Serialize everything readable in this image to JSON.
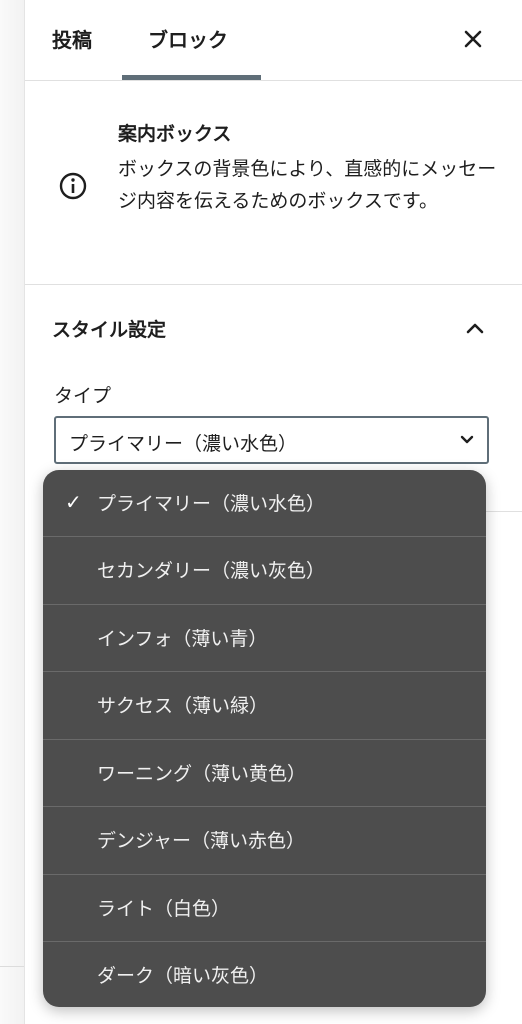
{
  "tabs": {
    "post": "投稿",
    "block": "ブロック"
  },
  "block": {
    "title": "案内ボックス",
    "description": "ボックスの背景色により、直感的にメッセージ内容を伝えるためのボックスです。"
  },
  "style_settings": {
    "header": "スタイル設定",
    "type_label": "タイプ",
    "selected": "プライマリー（濃い水色）",
    "options": [
      "プライマリー（濃い水色）",
      "セカンダリー（濃い灰色）",
      "インフォ（薄い青）",
      "サクセス（薄い緑）",
      "ワーニング（薄い黄色）",
      "デンジャー（薄い赤色）",
      "ライト（白色）",
      "ダーク（暗い灰色）"
    ],
    "selected_index": 0
  },
  "icons": {
    "close": "close-icon",
    "info": "info-icon",
    "collapse": "chevron-up-icon",
    "select": "chevron-down-icon",
    "selected_mark": "checkmark-icon"
  },
  "colors": {
    "tab_indicator": "#5f6e78",
    "dropdown_bg": "#4d4d4d",
    "select_border": "#5f6e78"
  }
}
